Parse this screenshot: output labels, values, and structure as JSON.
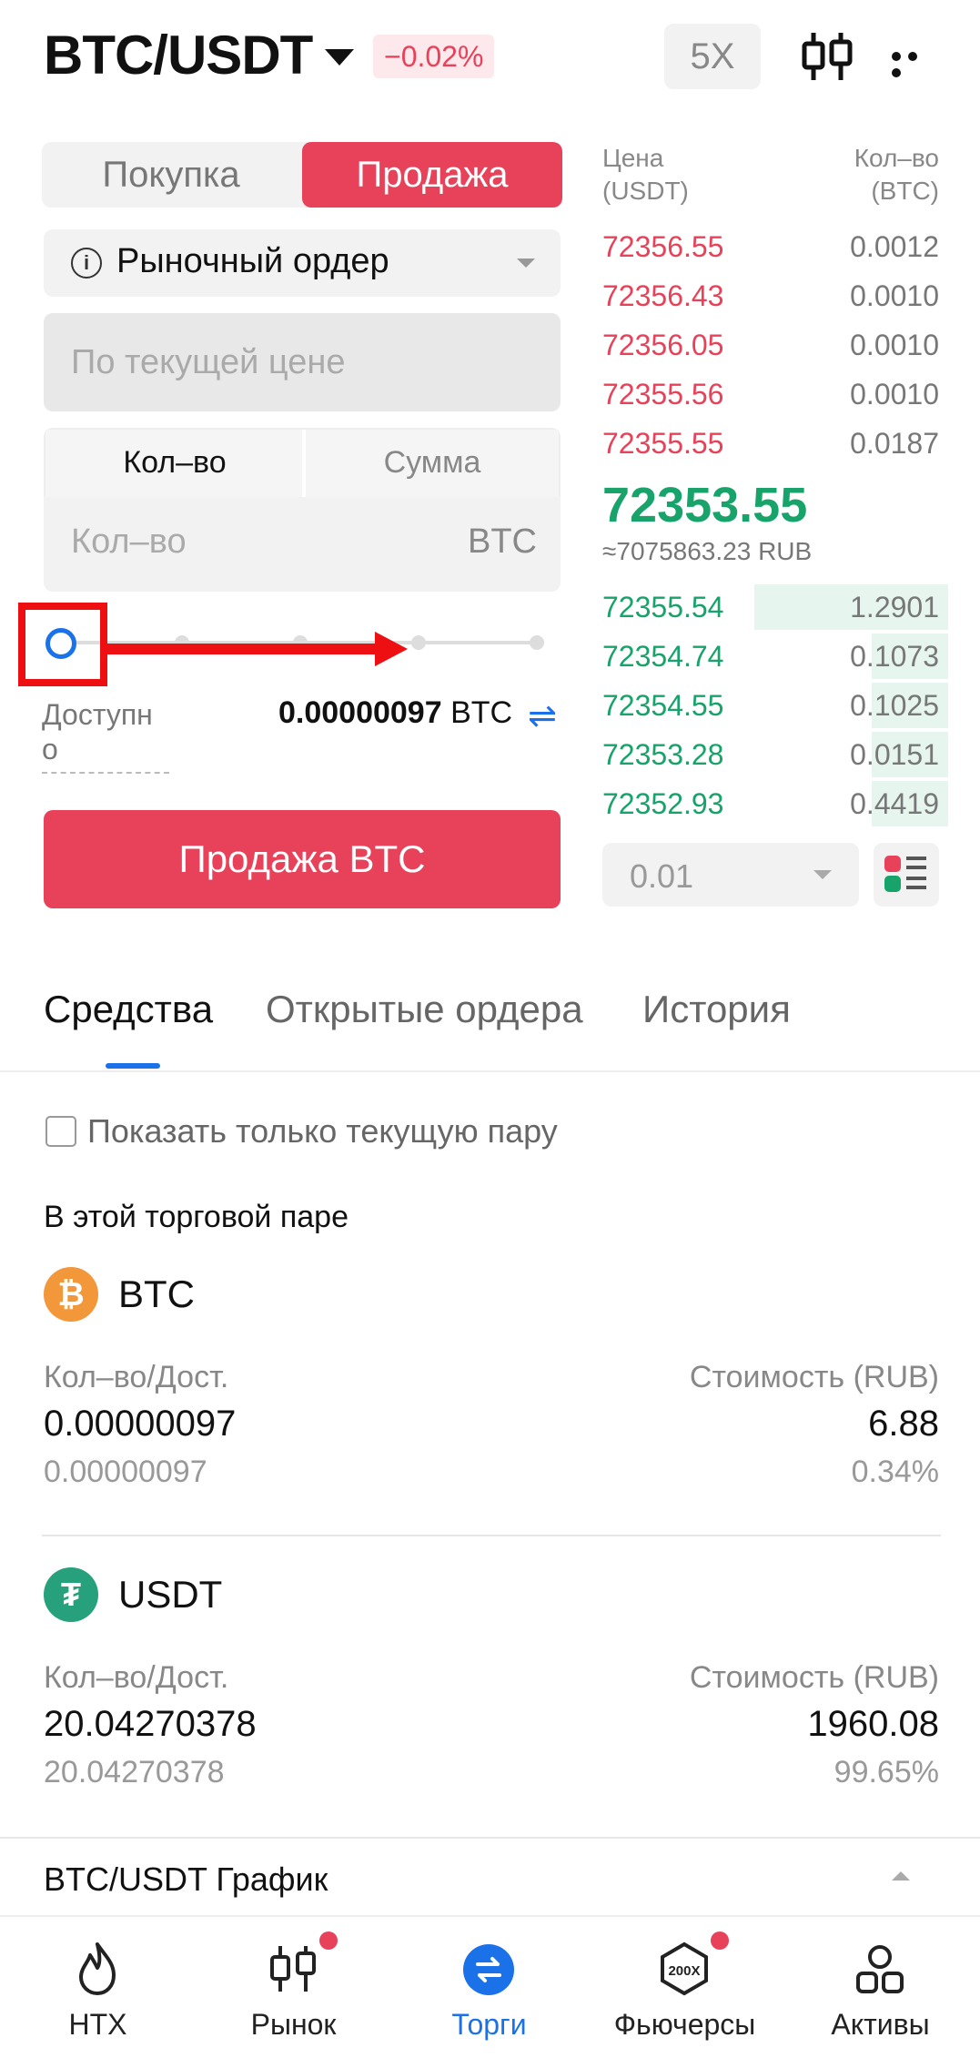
{
  "header": {
    "pair": "BTC/USDT",
    "change": "−0.02%",
    "leverage": "5X"
  },
  "trade": {
    "buy_tab": "Покупка",
    "sell_tab": "Продажа",
    "order_type": "Рыночный ордер",
    "price_placeholder": "По текущей цене",
    "qty_tab": "Кол–во",
    "sum_tab": "Сумма",
    "qty_placeholder": "Кол–во",
    "qty_unit": "BTC",
    "slider_percent": 0,
    "available_label_1": "Доступн",
    "available_label_2": "о",
    "available_value": "0.00000097",
    "available_unit": "BTC",
    "sell_button": "Продажа BTC"
  },
  "orderbook": {
    "price_header_1": "Цена",
    "price_header_2": "(USDT)",
    "qty_header_1": "Кол–во",
    "qty_header_2": "(BTC)",
    "asks": [
      {
        "price": "72356.55",
        "qty": "0.0012"
      },
      {
        "price": "72356.43",
        "qty": "0.0010"
      },
      {
        "price": "72356.05",
        "qty": "0.0010"
      },
      {
        "price": "72355.56",
        "qty": "0.0010"
      },
      {
        "price": "72355.55",
        "qty": "0.0187"
      }
    ],
    "last_price": "72353.55",
    "last_price_rub": "≈7075863.23 RUB",
    "bids": [
      {
        "price": "72355.54",
        "qty": "1.2901",
        "depth": 0.56
      },
      {
        "price": "72354.74",
        "qty": "0.1073",
        "depth": 0.22
      },
      {
        "price": "72354.55",
        "qty": "0.1025",
        "depth": 0.22
      },
      {
        "price": "72353.28",
        "qty": "0.0151",
        "depth": 0.22
      },
      {
        "price": "72352.93",
        "qty": "0.4419",
        "depth": 0.22
      }
    ],
    "precision": "0.01"
  },
  "tabs": {
    "funds": "Средства",
    "open_orders": "Открытые ордера",
    "history": "История"
  },
  "funds": {
    "show_only_current": "Показать только текущую пару",
    "section_title": "В этой торговой паре",
    "assets": [
      {
        "name": "BTC",
        "qty_label": "Кол–во/Дост.",
        "value_label": "Стоимость (RUB)",
        "qty": "0.00000097",
        "available": "0.00000097",
        "value": "6.88",
        "percent": "0.34%"
      },
      {
        "name": "USDT",
        "qty_label": "Кол–во/Дост.",
        "value_label": "Стоимость (RUB)",
        "qty": "20.04270378",
        "available": "20.04270378",
        "value": "1960.08",
        "percent": "99.65%"
      }
    ],
    "chart_row": "BTC/USDT График"
  },
  "nav": {
    "items": [
      "HTX",
      "Рынок",
      "Торги",
      "Фьючерсы",
      "Активы"
    ],
    "active": "Торги"
  },
  "colors": {
    "sell": "#e8425a",
    "buy": "#17a36a",
    "accent": "#1b72e8",
    "annotation": "#ee0f13"
  }
}
